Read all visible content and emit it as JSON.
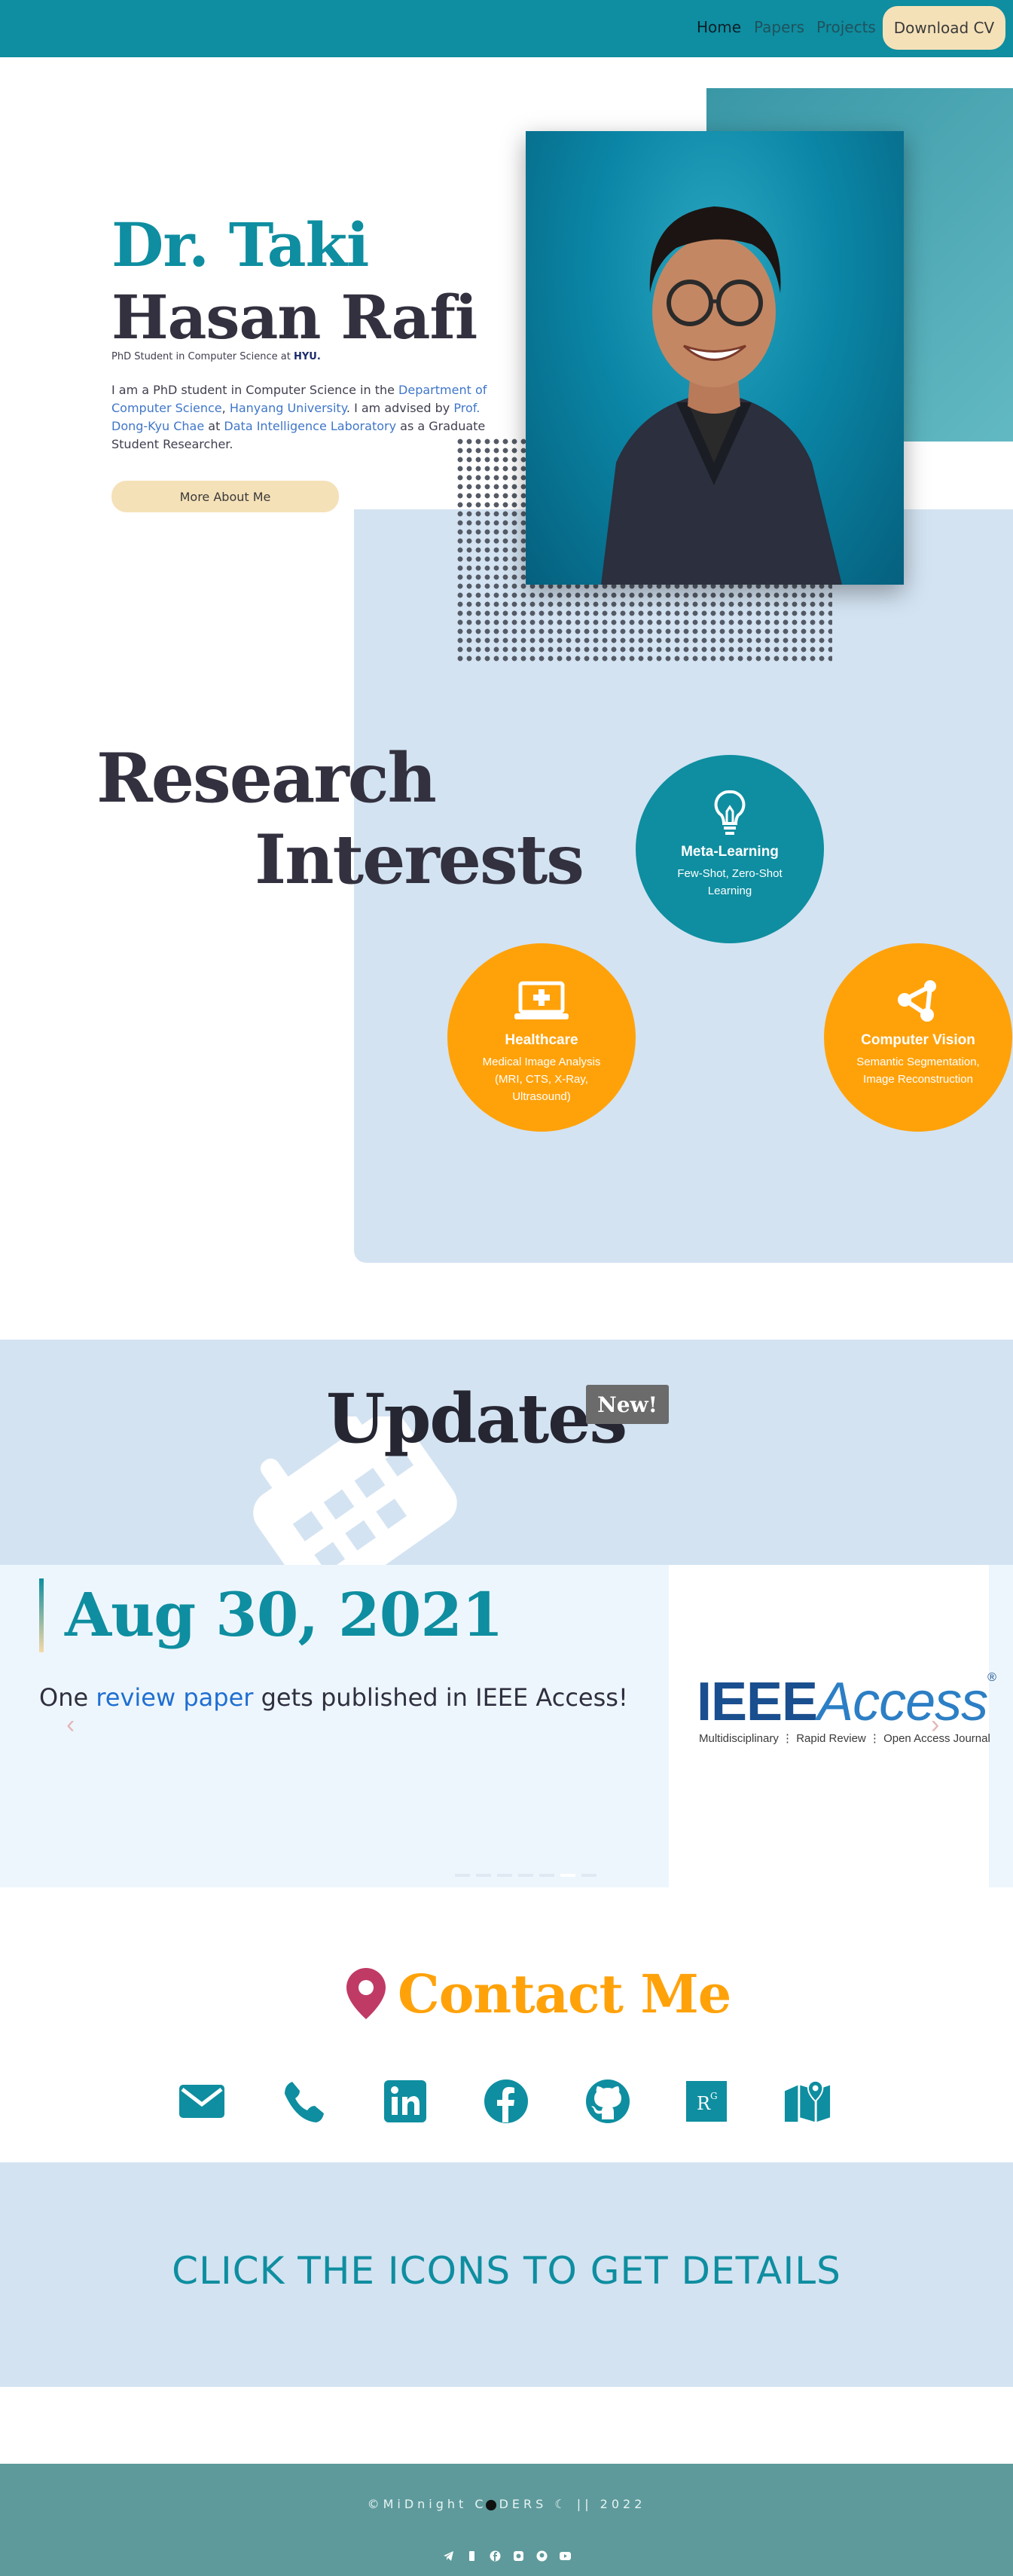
{
  "nav": {
    "home": "Home",
    "papers": "Papers",
    "projects": "Projects",
    "download_cv": "Download CV"
  },
  "hero": {
    "name_line1": "Dr. Taki",
    "name_line2": "Hasan Rafi",
    "tagline_prefix": "PhD Student in Computer Science at ",
    "tagline_org": "HYU.",
    "bio": {
      "p1": "I am a PhD student in Computer Science in the ",
      "l1": "Department of Computer Science",
      "p2": ", ",
      "l2": "Hanyang University",
      "p3": ". I am advised by ",
      "l3": "Prof. Dong-Kyu Chae",
      "p4": " at ",
      "l4": "Data Intelligence Laboratory",
      "p5": " as a Graduate Student Researcher."
    },
    "more_button": "More About Me"
  },
  "research": {
    "title_line1": "Research",
    "title_line2": "Interests",
    "items": [
      {
        "title": "Meta-Learning",
        "subtitle": "Few-Shot, Zero-Shot Learning",
        "icon": "lightbulb-icon",
        "color": "#0e8ea0"
      },
      {
        "title": "Healthcare",
        "subtitle": "Medical Image Analysis (MRI, CTS, X-Ray, Ultrasound)",
        "icon": "medical-laptop-icon",
        "color": "#ffa20a"
      },
      {
        "title": "Computer Vision",
        "subtitle": "Semantic Segmentation, Image Reconstruction",
        "icon": "nodes-icon",
        "color": "#ffa20a"
      }
    ]
  },
  "updates": {
    "title": "Updates",
    "badge": "New!",
    "slide": {
      "date": "Aug 30, 2021",
      "text_prefix": "One ",
      "link": "review paper",
      "text_suffix": " gets published in IEEE Access!",
      "logo_main": "IEEE",
      "logo_access": "Access",
      "logo_reg": "®",
      "logo_sub": "Multidisciplinary ⋮ Rapid Review ⋮ Open Access Journal"
    },
    "prev": "‹",
    "next": "›"
  },
  "contact": {
    "title": "Contact Me",
    "icons": [
      "email-icon",
      "phone-icon",
      "linkedin-icon",
      "facebook-icon",
      "github-icon",
      "researchgate-icon",
      "map-icon"
    ],
    "cta": "CLICK THE ICONS TO GET DETAILS"
  },
  "footer": {
    "text_left": "©MiDnight C",
    "text_mid": "DERS",
    "text_right": "|| 2022"
  },
  "colors": {
    "teal": "#0e8ea0",
    "orange": "#ffa20a",
    "light_blue": "#d3e3f2",
    "cream": "#f5e1b8",
    "footer": "#5e9a9b"
  }
}
